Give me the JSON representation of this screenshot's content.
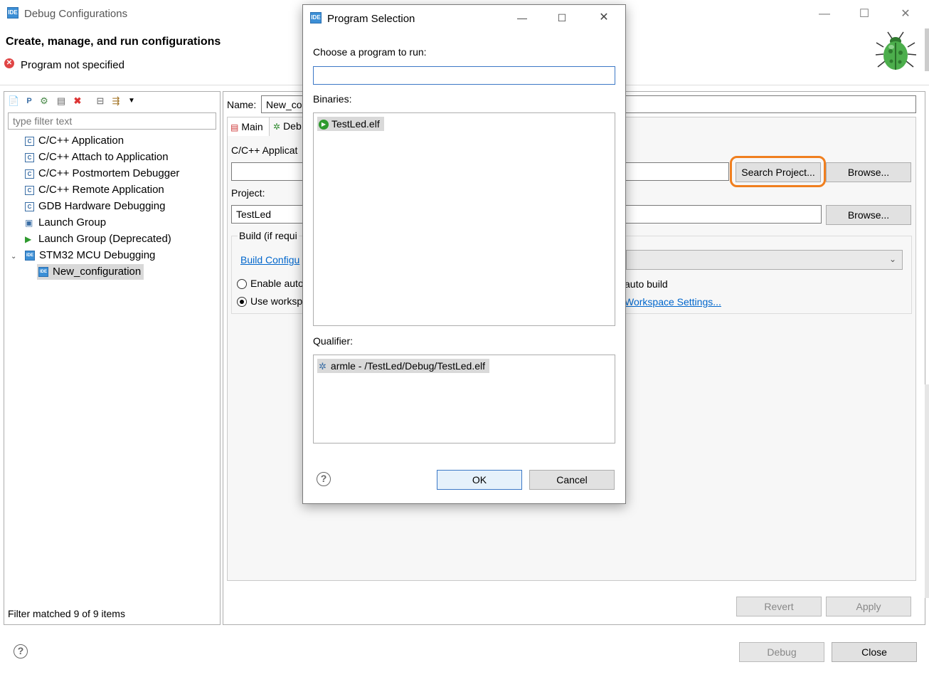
{
  "window": {
    "title": "Debug Configurations",
    "header_title": "Create, manage, and run configurations",
    "error_message": "Program not specified"
  },
  "left": {
    "filter_placeholder": "type filter text",
    "tree": [
      {
        "label": "C/C++ Application",
        "icon": "c-icon"
      },
      {
        "label": "C/C++ Attach to Application",
        "icon": "c-icon"
      },
      {
        "label": "C/C++ Postmortem Debugger",
        "icon": "c-icon"
      },
      {
        "label": "C/C++ Remote Application",
        "icon": "c-icon"
      },
      {
        "label": "GDB Hardware Debugging",
        "icon": "c-icon"
      },
      {
        "label": "Launch Group",
        "icon": "launch-group-icon"
      },
      {
        "label": "Launch Group (Deprecated)",
        "icon": "play-icon"
      },
      {
        "label": "STM32 MCU Debugging",
        "icon": "ide-icon"
      },
      {
        "label": "New_configuration",
        "icon": "ide-icon"
      }
    ],
    "status": "Filter matched 9 of 9 items"
  },
  "right": {
    "name_label": "Name:",
    "name_value": "New_co",
    "tab_main": "Main",
    "tab_debugger": "Deb",
    "app_label": "C/C++ Applicat",
    "search_project": "Search Project...",
    "browse": "Browse...",
    "project_label": "Project:",
    "project_value": "TestLed",
    "build_label": "Build (if requi",
    "build_config_link": "Build Configu",
    "enable_auto": "Enable auto",
    "disable_auto": "auto build",
    "use_workspace": "Use worksp",
    "workspace_link": "Workspace Settings...",
    "revert": "Revert",
    "apply": "Apply"
  },
  "footer": {
    "debug": "Debug",
    "close": "Close"
  },
  "dialog": {
    "title": "Program Selection",
    "choose_label": "Choose a program to run:",
    "input_value": "",
    "binaries_label": "Binaries:",
    "binary_item": "TestLed.elf",
    "qualifier_label": "Qualifier:",
    "qualifier_item": "armle - /TestLed/Debug/TestLed.elf",
    "ok": "OK",
    "cancel": "Cancel"
  },
  "colors": {
    "highlight_ring": "#f07f1f",
    "ide_blue": "#3c8fd6",
    "link": "#0066cc"
  }
}
